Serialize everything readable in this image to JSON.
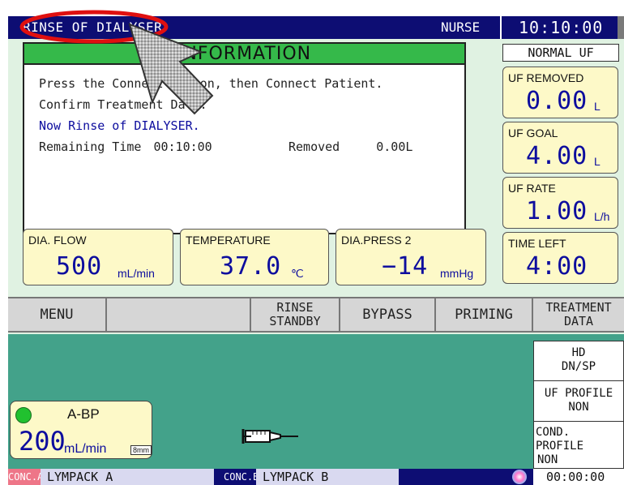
{
  "topbar": {
    "mode": "RINSE OF DIALYSER",
    "user": "NURSE",
    "time": "10:10:00"
  },
  "uf_mode": "NORMAL UF",
  "info": {
    "title": "INFORMATION",
    "line1": "Press the Connect Button, then Connect Patient.",
    "line2": "Confirm Treatment Data.",
    "line3": "Now Rinse of DIALYSER.",
    "remaining_label": "Remaining Time",
    "remaining_value": "00:10:00",
    "removed_label": "Removed",
    "removed_value": "0.00L",
    "line3_color": "#0d0d9e"
  },
  "side": {
    "uf_removed": {
      "label": "UF REMOVED",
      "value": "0.00",
      "unit": "L"
    },
    "uf_goal": {
      "label": "UF GOAL",
      "value": "4.00",
      "unit": "L"
    },
    "uf_rate": {
      "label": "UF RATE",
      "value": "1.00",
      "unit": "L/h"
    },
    "time_left": {
      "label": "TIME LEFT",
      "value": "4:00"
    }
  },
  "dia": {
    "flow": {
      "label": "DIA. FLOW",
      "value": "500",
      "unit": "mL/min"
    },
    "temperature": {
      "label": "TEMPERATURE",
      "value": "37.0",
      "unit": "℃"
    },
    "press": {
      "label": "DIA.PRESS 2",
      "value": "−14",
      "unit": "mmHg"
    }
  },
  "buttons": {
    "menu": "MENU",
    "rinse_standby_1": "RINSE",
    "rinse_standby_2": "STANDBY",
    "bypass": "BYPASS",
    "priming": "PRIMING",
    "treatment_data_1": "TREATMENT",
    "treatment_data_2": "DATA"
  },
  "right_panel": {
    "hd_1": "HD",
    "hd_2": "DN/SP",
    "uf_profile_1": "UF PROFILE",
    "uf_profile_2": "NON",
    "cond_profile_1": "COND. PROFILE",
    "cond_profile_2": "NON"
  },
  "abp": {
    "label": "A-BP",
    "value": "200",
    "unit": "mL/min",
    "tube": "8mm",
    "indicator_color": "#21c12f"
  },
  "status": {
    "conc_a_label": "CONC.A",
    "conc_a_value": "LYMPACK A",
    "conc_b_label": "CONC.B",
    "conc_b_value": "LYMPACK B",
    "elapsed": "00:00:00"
  },
  "overlay": {
    "highlight_color": "#e01010",
    "cursor": "large-arrow-cursor-icon"
  },
  "icons": {
    "syringe": "syringe-icon",
    "status_dot": "status-dot-icon",
    "cond_gradient": "gradient-icon"
  }
}
